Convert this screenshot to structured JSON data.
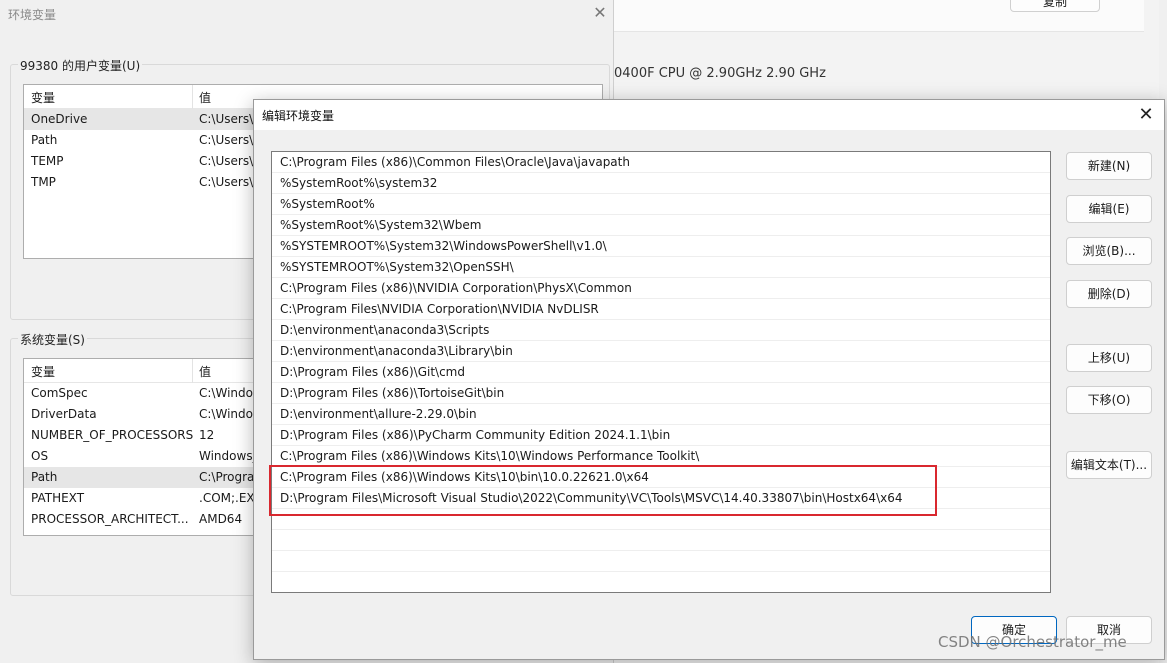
{
  "background_settings": {
    "copy_button": "复制",
    "cpu_text": "0400F CPU @ 2.90GHz   2.90 GHz"
  },
  "env_dialog": {
    "title": "环境变量",
    "user_group_label": "99380 的用户变量(U)",
    "system_group_label": "系统变量(S)",
    "col_variable": "变量",
    "col_value": "值",
    "user_vars": [
      {
        "name": "OneDrive",
        "value": "C:\\Users\\"
      },
      {
        "name": "Path",
        "value": "C:\\Users\\"
      },
      {
        "name": "TEMP",
        "value": "C:\\Users\\"
      },
      {
        "name": "TMP",
        "value": "C:\\Users\\"
      }
    ],
    "system_vars": [
      {
        "name": "ComSpec",
        "value": "C:\\Windo"
      },
      {
        "name": "DriverData",
        "value": "C:\\Windo"
      },
      {
        "name": "NUMBER_OF_PROCESSORS",
        "value": "12"
      },
      {
        "name": "OS",
        "value": "Windows_"
      },
      {
        "name": "Path",
        "value": "C:\\Progra"
      },
      {
        "name": "PATHEXT",
        "value": ".COM;.EX"
      },
      {
        "name": "PROCESSOR_ARCHITECT...",
        "value": "AMD64"
      }
    ]
  },
  "edit_dialog": {
    "title": "编辑环境变量",
    "paths": [
      "C:\\Program Files (x86)\\Common Files\\Oracle\\Java\\javapath",
      "%SystemRoot%\\system32",
      "%SystemRoot%",
      "%SystemRoot%\\System32\\Wbem",
      "%SYSTEMROOT%\\System32\\WindowsPowerShell\\v1.0\\",
      "%SYSTEMROOT%\\System32\\OpenSSH\\",
      "C:\\Program Files (x86)\\NVIDIA Corporation\\PhysX\\Common",
      "C:\\Program Files\\NVIDIA Corporation\\NVIDIA NvDLISR",
      "D:\\environment\\anaconda3\\Scripts",
      "D:\\environment\\anaconda3\\Library\\bin",
      "D:\\Program Files (x86)\\Git\\cmd",
      "D:\\Program Files (x86)\\TortoiseGit\\bin",
      "D:\\environment\\allure-2.29.0\\bin",
      "D:\\Program Files (x86)\\PyCharm Community Edition 2024.1.1\\bin",
      "C:\\Program Files (x86)\\Windows Kits\\10\\Windows Performance Toolkit\\",
      "C:\\Program Files (x86)\\Windows Kits\\10\\bin\\10.0.22621.0\\x64",
      "D:\\Program Files\\Microsoft Visual Studio\\2022\\Community\\VC\\Tools\\MSVC\\14.40.33807\\bin\\Hostx64\\x64"
    ],
    "buttons": {
      "new": "新建(N)",
      "edit": "编辑(E)",
      "browse": "浏览(B)...",
      "delete": "删除(D)",
      "move_up": "上移(U)",
      "move_down": "下移(O)",
      "edit_text": "编辑文本(T)...",
      "ok": "确定",
      "cancel": "取消"
    }
  },
  "watermark": "CSDN @Orchestrator_me"
}
